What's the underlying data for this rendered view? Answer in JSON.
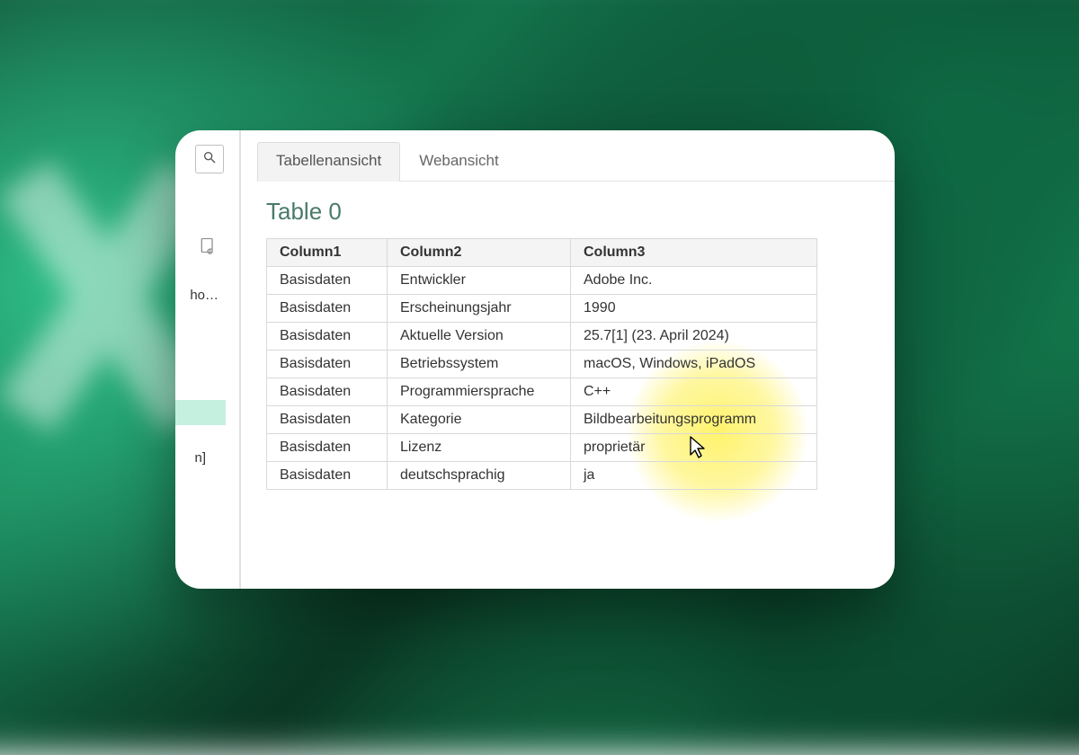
{
  "sidebar": {
    "cut_text_1": "ho…",
    "cut_text_2": "n]"
  },
  "tabs": {
    "table_view": "Tabellenansicht",
    "web_view": "Webansicht"
  },
  "title": "Table 0",
  "table": {
    "headers": {
      "c1": "Column1",
      "c2": "Column2",
      "c3": "Column3"
    },
    "rows": [
      {
        "c1": "Basisdaten",
        "c2": "Entwickler",
        "c3": "Adobe Inc."
      },
      {
        "c1": "Basisdaten",
        "c2": "Erscheinungsjahr",
        "c3": "1990"
      },
      {
        "c1": "Basisdaten",
        "c2": "Aktuelle Version",
        "c3": "25.7[1] (23. April 2024)"
      },
      {
        "c1": "Basisdaten",
        "c2": "Betriebssystem",
        "c3": "macOS, Windows, iPadOS"
      },
      {
        "c1": "Basisdaten",
        "c2": "Programmiersprache",
        "c3": "C++"
      },
      {
        "c1": "Basisdaten",
        "c2": "Kategorie",
        "c3": "Bildbearbeitungsprogramm"
      },
      {
        "c1": "Basisdaten",
        "c2": "Lizenz",
        "c3": "proprietär"
      },
      {
        "c1": "Basisdaten",
        "c2": "deutschsprachig",
        "c3": "ja"
      }
    ]
  }
}
